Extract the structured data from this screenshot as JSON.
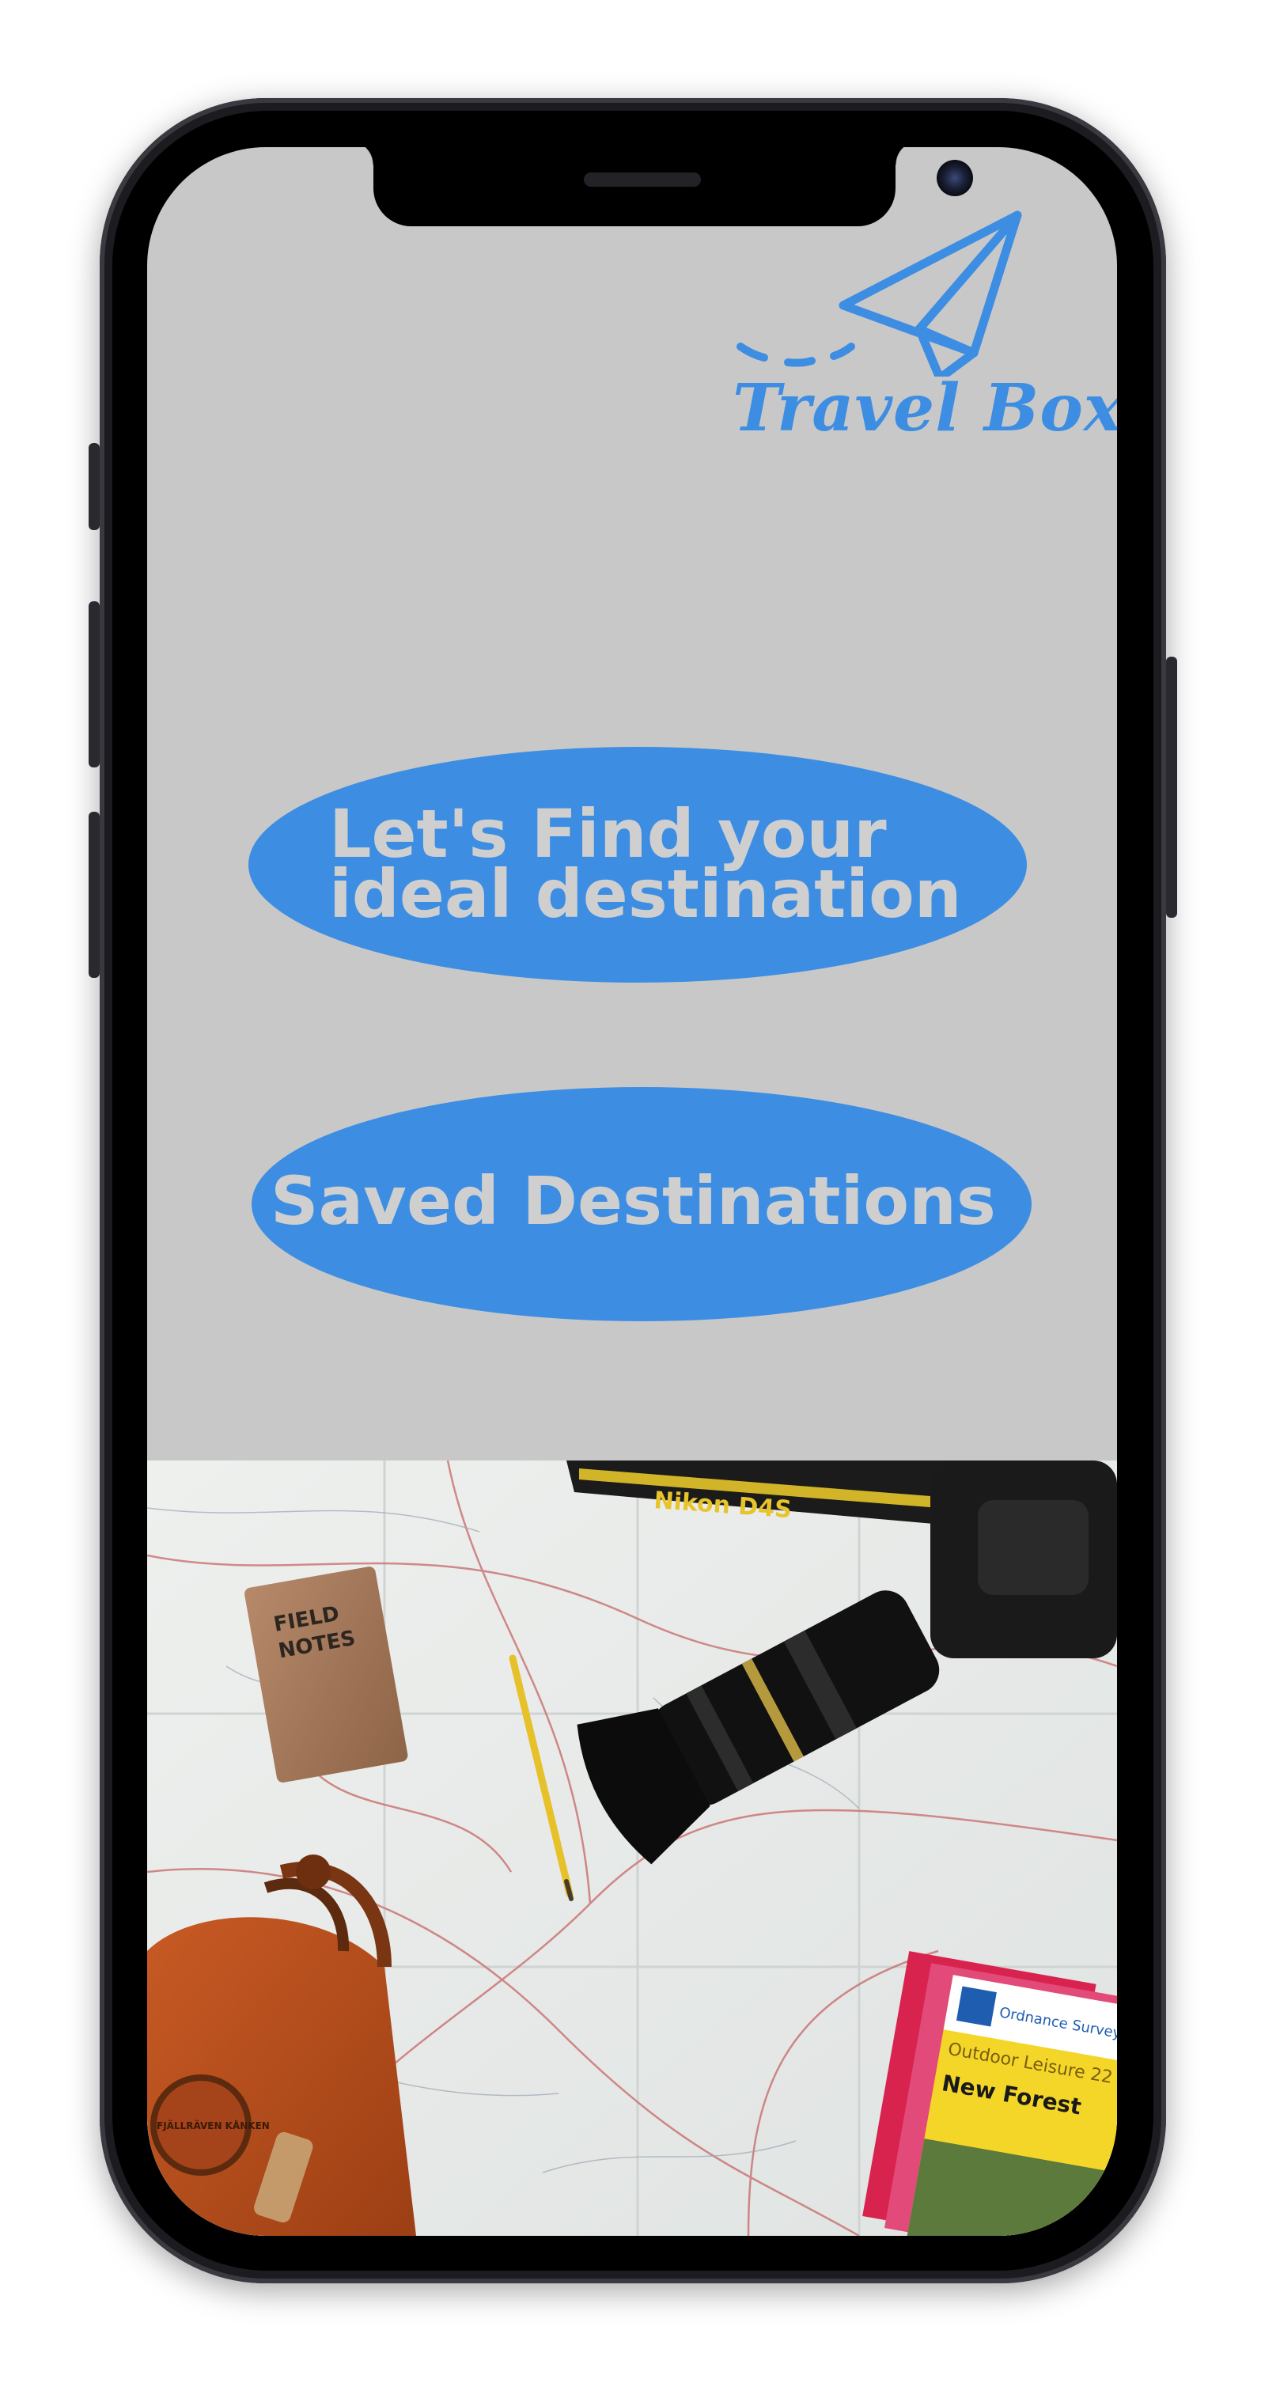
{
  "app": {
    "name": "Travel Box"
  },
  "logo": {
    "icon": "paper-plane-icon",
    "text": "Travel Box"
  },
  "main": {
    "find_button": {
      "line1": "Let's Find your",
      "line2": "ideal destination"
    },
    "saved_button": {
      "label": "Saved Destinations"
    }
  },
  "hero_image": {
    "notebook_line1": "FIELD",
    "notebook_line2": "NOTES",
    "strap_text": "Nikon D4S",
    "map_title": "New Forest",
    "map_series": "Outdoor Leisure 22",
    "map_publisher": "Ordnance Survey",
    "bag_brand": "FJÄLLRÄVEN KÅNKEN"
  },
  "colors": {
    "accent": "#3d8ee3",
    "screen_background": "#c8c8c8",
    "button_text": "#cfcfcf",
    "phone_frame": "#1c1b20"
  }
}
